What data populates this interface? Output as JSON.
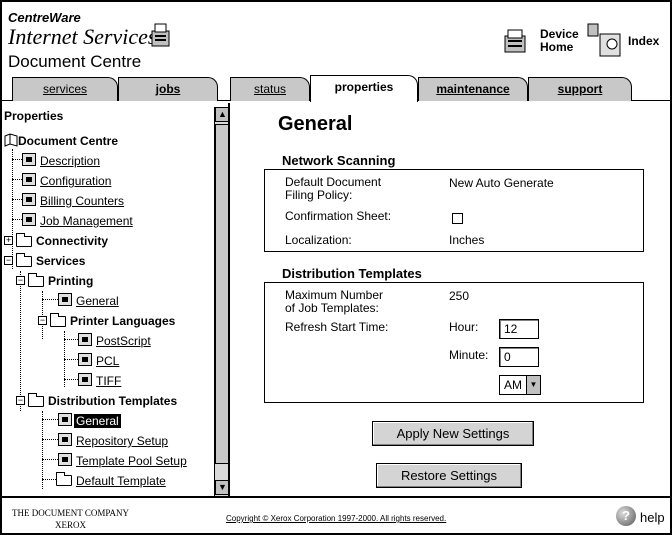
{
  "header": {
    "brand_line1": "CentreWare",
    "brand_line2": "Internet Services",
    "app_title": "Document Centre",
    "device_home": "Device Home",
    "device_home_l1": "Device",
    "device_home_l2": "Home",
    "index": "Index"
  },
  "tabs": [
    {
      "label": "services"
    },
    {
      "label": "jobs"
    },
    {
      "label": "status"
    },
    {
      "label": "properties",
      "active": true
    },
    {
      "label": "maintenance"
    },
    {
      "label": "support"
    }
  ],
  "sidebar": {
    "title": "Properties",
    "root": "Document Centre",
    "items": {
      "description": "Description",
      "configuration": "Configuration",
      "billing_counters": "Billing Counters",
      "job_management": "Job Management",
      "connectivity": "Connectivity",
      "services": "Services",
      "printing": "Printing",
      "general": "General",
      "printer_languages": "Printer Languages",
      "postscript": "PostScript",
      "pcl": "PCL",
      "tiff": "TIFF",
      "distribution_templates": "Distribution Templates",
      "dt_general": "General",
      "repository_setup": "Repository Setup",
      "template_pool_setup": "Template Pool Setup",
      "default_template": "Default Template"
    }
  },
  "main": {
    "page_title": "General",
    "network_scanning": {
      "title": "Network Scanning",
      "filing_policy_label_l1": "Default Document",
      "filing_policy_label_l2": "Filing Policy:",
      "filing_policy_value": "New Auto Generate",
      "confirmation_label": "Confirmation Sheet:",
      "confirmation_checked": false,
      "localization_label": "Localization:",
      "localization_value": "Inches"
    },
    "distribution_templates": {
      "title": "Distribution Templates",
      "max_label_l1": "Maximum Number",
      "max_label_l2": "of Job Templates:",
      "max_value": "250",
      "refresh_label": "Refresh Start Time:",
      "hour_label": "Hour:",
      "hour_value": "12",
      "minute_label": "Minute:",
      "minute_value": "0",
      "ampm_value": "AM"
    },
    "apply_button": "Apply New Settings",
    "restore_button": "Restore Settings"
  },
  "footer": {
    "company_l1": "THE DOCUMENT COMPANY",
    "company_l2": "XEROX",
    "copyright": "Copyright © Xerox Corporation 1997-2000. All rights reserved.",
    "help": "help"
  },
  "icons": {
    "help": "help-icon",
    "device_home": "device-home-icon",
    "index": "index-icon",
    "printer": "printer-icon"
  }
}
